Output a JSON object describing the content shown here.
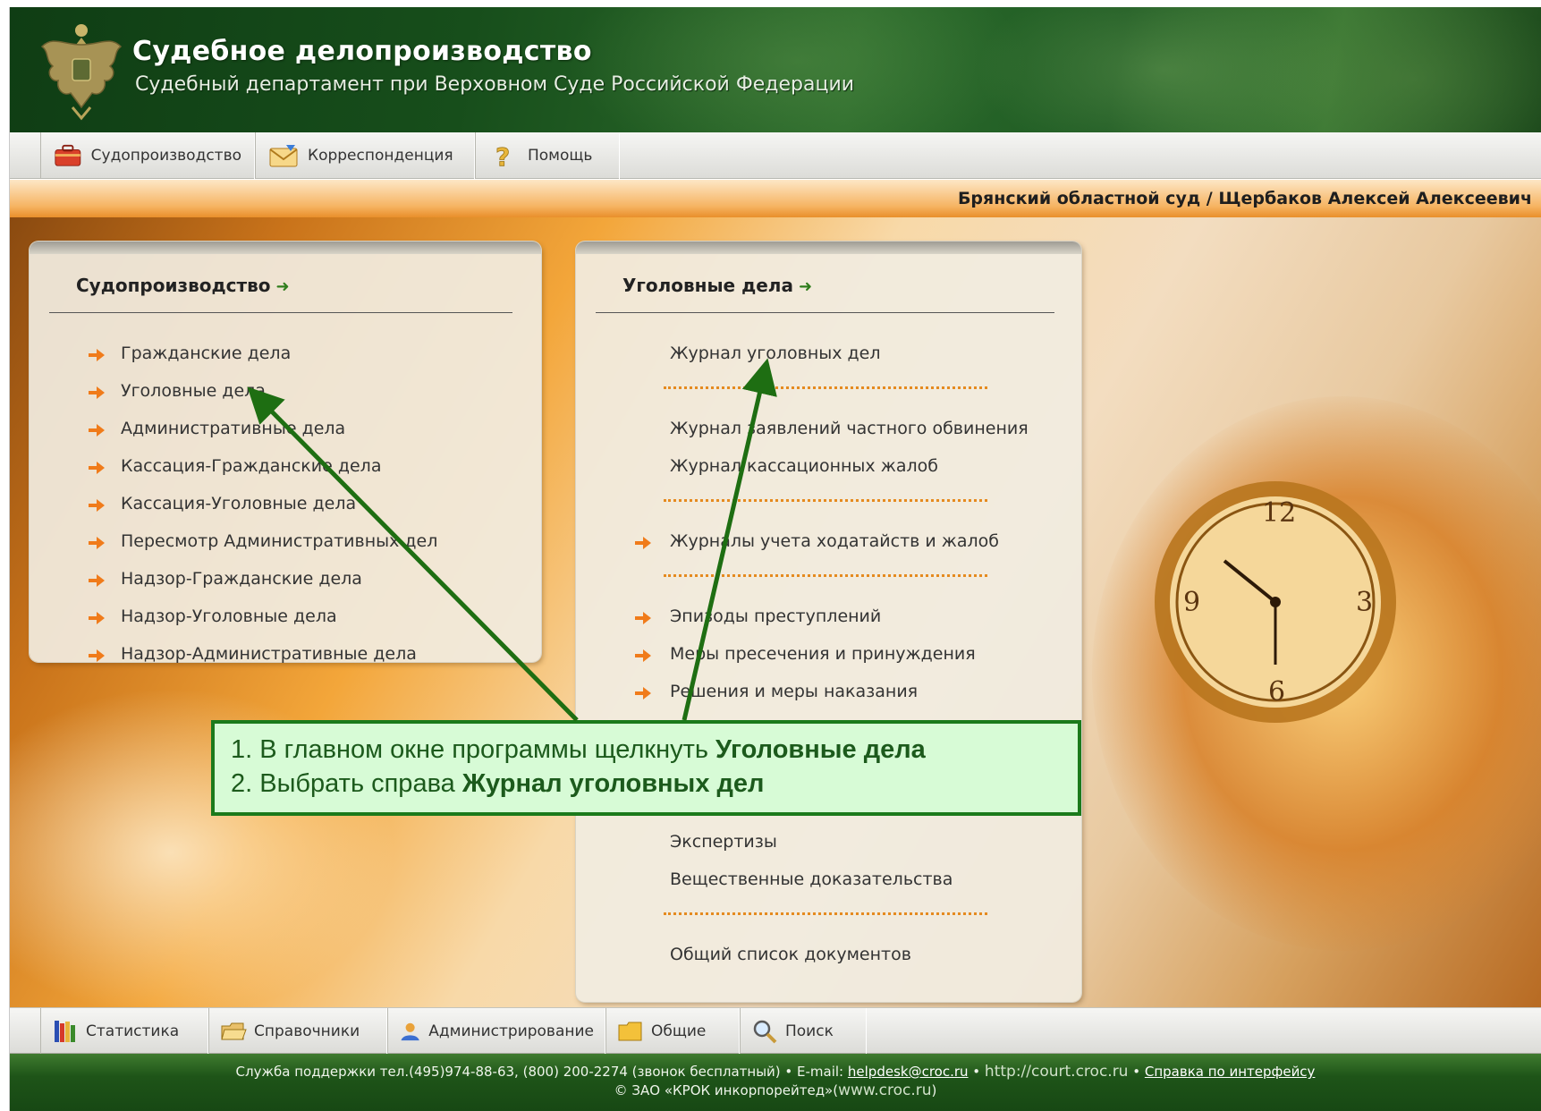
{
  "header": {
    "title": "Судебное делопроизводство",
    "subtitle": "Судебный департамент при Верховном Суде Российской Федерации"
  },
  "top_toolbar": {
    "items": [
      {
        "label": "Судопроизводство",
        "icon": "briefcase-icon"
      },
      {
        "label": "Корреспонденция",
        "icon": "envelope-icon"
      },
      {
        "label": "Помощь",
        "icon": "question-icon"
      }
    ]
  },
  "user_bar": {
    "text": "Брянский областной суд / Щербаков Алексей Алексеевич"
  },
  "left_panel": {
    "title": "Судопроизводство",
    "items": [
      "Гражданские дела",
      "Уголовные дела",
      "Административные дела",
      "Кассация-Гражданские дела",
      "Кассация-Уголовные дела",
      "Пересмотр Административных дел",
      "Надзор-Гражданские дела",
      "Надзор-Уголовные дела",
      "Надзор-Административные дела"
    ]
  },
  "right_panel": {
    "title": "Уголовные дела",
    "items": [
      "Журнал уголовных дел",
      "Журнал заявлений частного обвинения",
      "Журнал кассационных жалоб",
      "Журналы учета ходатайств и жалоб",
      "Эпизоды преступлений",
      "Меры пресечения и принуждения",
      "Решения и меры наказания",
      "Экспертизы",
      "Вещественные доказательства",
      "Общий список документов"
    ]
  },
  "callout": {
    "line1_prefix": "1. В главном окне программы щелкнуть ",
    "line1_bold": "Уголовные дела",
    "line2_prefix": "2. Выбрать справа ",
    "line2_bold": "Журнал уголовных дел"
  },
  "bottom_toolbar": {
    "items": [
      {
        "label": "Статистика",
        "icon": "books-icon"
      },
      {
        "label": "Справочники",
        "icon": "folder-open-icon"
      },
      {
        "label": "Администрирование",
        "icon": "user-icon"
      },
      {
        "label": "Общие",
        "icon": "folder-icon"
      },
      {
        "label": "Поиск",
        "icon": "magnifier-icon"
      }
    ]
  },
  "footer": {
    "support_prefix": "Служба поддержки тел.(495)974-88-63, (800) 200-2274 (звонок бесплатный) • E-mail: ",
    "email": "helpdesk@croc.ru",
    "sep1": " • ",
    "site": "http://court.croc.ru",
    "sep2": " • ",
    "help_link": "Справка по интерфейсу",
    "copyright": "© ЗАО «КРОК инкорпорейтед»(",
    "company_url": "www.croc.ru",
    "copyright_end": ")"
  },
  "colors": {
    "header_green": "#174e1b",
    "accent_orange": "#f39a2c",
    "callout_bg": "#d7fbd6",
    "callout_border": "#1b7a1b"
  }
}
